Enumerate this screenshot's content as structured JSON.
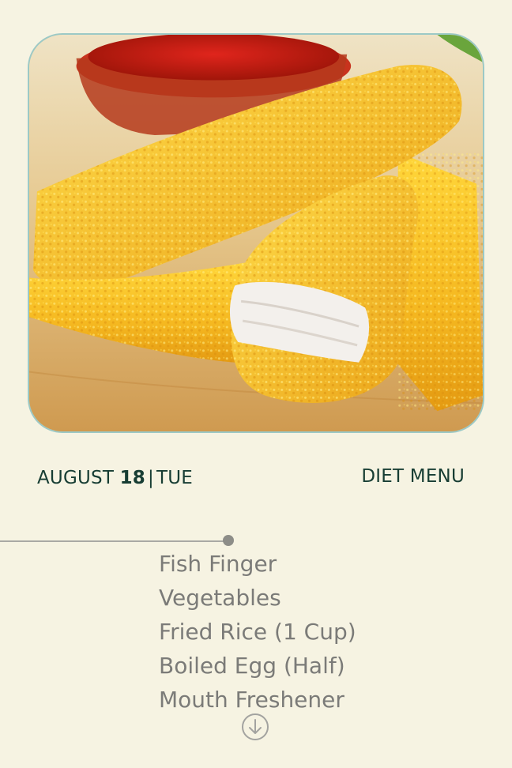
{
  "header": {
    "date_month": "AUGUST",
    "date_day": "18",
    "date_separator": "|",
    "date_weekday": "TUE",
    "title": "DIET MENU"
  },
  "hero": {
    "image_description_icon": "food-photo"
  },
  "menu": {
    "items": [
      "Fish Finger",
      "Vegetables",
      "Fried Rice (1 Cup)",
      "Boiled Egg (Half)",
      "Mouth Freshener"
    ]
  },
  "controls": {
    "scroll_icon": "arrow-down-circle-icon"
  },
  "colors": {
    "background": "#f6f3e2",
    "heading": "#173d33",
    "menu_text": "#7b7b78",
    "divider": "#a9a9a4",
    "image_border": "#9cc9c6"
  }
}
